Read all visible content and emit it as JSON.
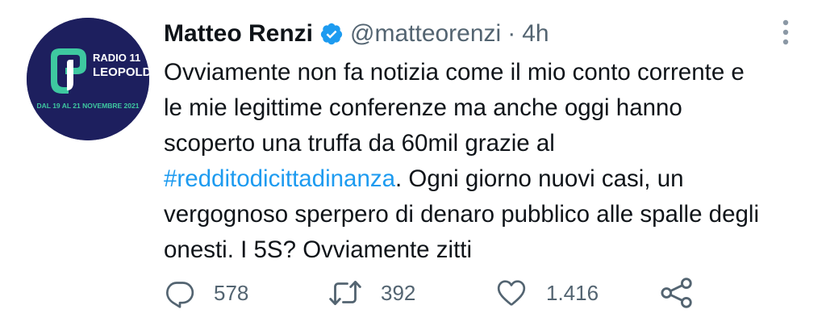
{
  "author": {
    "name": "Matteo Renzi",
    "handle": "@matteorenzi",
    "separator": "·",
    "time": "4h",
    "verified": true,
    "avatar": {
      "logo_line1": "RADIO 11",
      "logo_line2": "LEOPOLDA",
      "logo_dates": "DAL 19 AL 21 NOVEMBRE 2021"
    }
  },
  "tweet": {
    "line1": "Ovviamente non fa notizia come il mio conto corrente e",
    "line2": "le mie legittime conferenze ma anche oggi hanno",
    "line3": "scoperto una truffa da 60mil grazie al",
    "hashtag": "#redditodicittadinanza",
    "line4_rest": ". Ogni giorno nuovi casi, un",
    "line5": "vergognoso sperpero di denaro pubblico alle spalle degli",
    "line6": "onesti. I 5S? Ovviamente zitti"
  },
  "actions": {
    "reply": {
      "icon": "reply-icon",
      "count": "578"
    },
    "retweet": {
      "icon": "retweet-icon",
      "count": "392"
    },
    "like": {
      "icon": "heart-icon",
      "count": "1.416"
    },
    "share": {
      "icon": "share-icon"
    }
  },
  "colors": {
    "text": "#0f1419",
    "secondary": "#536471",
    "link": "#1d9bf0",
    "verified": "#1d9bf0",
    "avatar_bg": "#1d1f5e",
    "avatar_accent": "#3ec8a0"
  }
}
